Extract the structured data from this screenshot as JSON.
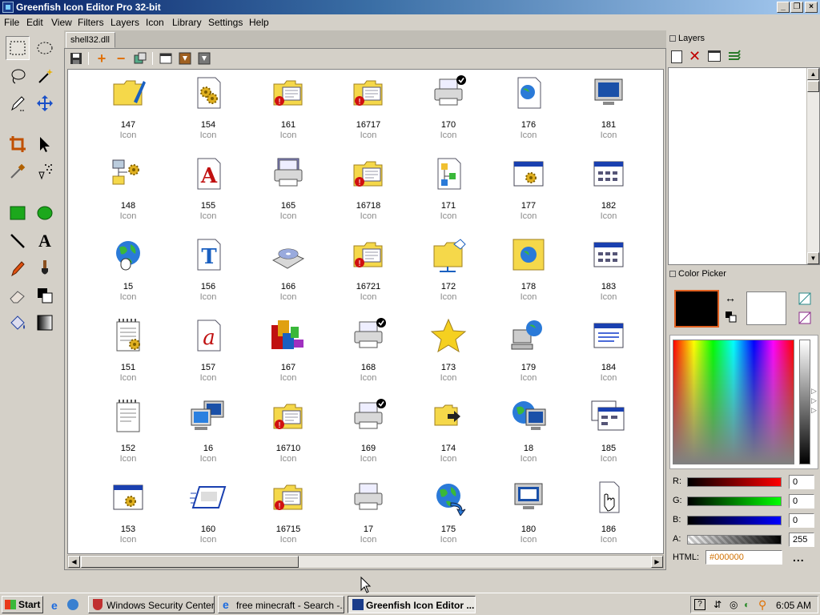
{
  "window": {
    "title": "Greenfish Icon Editor Pro 32-bit"
  },
  "menu": [
    "File",
    "Edit",
    "View",
    "Filters",
    "Layers",
    "Icon",
    "Library",
    "Settings",
    "Help"
  ],
  "document": {
    "tab_label": "shell32.dll"
  },
  "icons": [
    {
      "n": "147",
      "t": "Icon",
      "k": "folder-pen"
    },
    {
      "n": "154",
      "t": "Icon",
      "k": "gear-doc"
    },
    {
      "n": "161",
      "t": "Icon",
      "k": "folder-err"
    },
    {
      "n": "16717",
      "t": "Icon",
      "k": "folder-err"
    },
    {
      "n": "170",
      "t": "Icon",
      "k": "printer-check"
    },
    {
      "n": "176",
      "t": "Icon",
      "k": "globe-doc"
    },
    {
      "n": "181",
      "t": "Icon",
      "k": "monitor"
    },
    {
      "n": "148",
      "t": "Icon",
      "k": "net-gear"
    },
    {
      "n": "155",
      "t": "Icon",
      "k": "font-a"
    },
    {
      "n": "165",
      "t": "Icon",
      "k": "printer-pipe"
    },
    {
      "n": "16718",
      "t": "Icon",
      "k": "folder-err"
    },
    {
      "n": "171",
      "t": "Icon",
      "k": "tree-doc"
    },
    {
      "n": "177",
      "t": "Icon",
      "k": "window-gear"
    },
    {
      "n": "182",
      "t": "Icon",
      "k": "window-grid"
    },
    {
      "n": "15",
      "t": "Icon",
      "k": "globe-mouse"
    },
    {
      "n": "156",
      "t": "Icon",
      "k": "font-t"
    },
    {
      "n": "166",
      "t": "Icon",
      "k": "cd-drive"
    },
    {
      "n": "16721",
      "t": "Icon",
      "k": "folder-err"
    },
    {
      "n": "172",
      "t": "Icon",
      "k": "folder-net"
    },
    {
      "n": "178",
      "t": "Icon",
      "k": "globe-frame"
    },
    {
      "n": "183",
      "t": "Icon",
      "k": "window-grid"
    },
    {
      "n": "151",
      "t": "Icon",
      "k": "notepad-gear"
    },
    {
      "n": "157",
      "t": "Icon",
      "k": "font-a-italic"
    },
    {
      "n": "167",
      "t": "Icon",
      "k": "blocks"
    },
    {
      "n": "168",
      "t": "Icon",
      "k": "printer-check"
    },
    {
      "n": "173",
      "t": "Icon",
      "k": "star"
    },
    {
      "n": "179",
      "t": "Icon",
      "k": "globe-pc"
    },
    {
      "n": "184",
      "t": "Icon",
      "k": "window-list"
    },
    {
      "n": "152",
      "t": "Icon",
      "k": "notepad"
    },
    {
      "n": "16",
      "t": "Icon",
      "k": "computers"
    },
    {
      "n": "16710",
      "t": "Icon",
      "k": "folder-err"
    },
    {
      "n": "169",
      "t": "Icon",
      "k": "printer-check"
    },
    {
      "n": "174",
      "t": "Icon",
      "k": "folder-arrow"
    },
    {
      "n": "18",
      "t": "Icon",
      "k": "globe-monitor"
    },
    {
      "n": "185",
      "t": "Icon",
      "k": "window-stack"
    },
    {
      "n": "153",
      "t": "Icon",
      "k": "window-gear"
    },
    {
      "n": "160",
      "t": "Icon",
      "k": "window-speed"
    },
    {
      "n": "16715",
      "t": "Icon",
      "k": "folder-err"
    },
    {
      "n": "17",
      "t": "Icon",
      "k": "printer"
    },
    {
      "n": "175",
      "t": "Icon",
      "k": "globe-arrow"
    },
    {
      "n": "180",
      "t": "Icon",
      "k": "monitor-screen"
    },
    {
      "n": "186",
      "t": "Icon",
      "k": "hand-doc"
    }
  ],
  "panels": {
    "layers_title": "Layers",
    "color_title": "Color Picker"
  },
  "color": {
    "r_label": "R:",
    "g_label": "G:",
    "b_label": "B:",
    "a_label": "A:",
    "html_label": "HTML:",
    "r": "0",
    "g": "0",
    "b": "0",
    "a": "255",
    "html": "#000000",
    "more": "...",
    "primary": "#000000",
    "secondary": "#ffffff"
  },
  "taskbar": {
    "start": "Start",
    "tasks": [
      "Windows Security Center",
      "free minecraft - Search -...",
      "Greenfish Icon Editor ..."
    ],
    "clock": "6:05 AM"
  }
}
